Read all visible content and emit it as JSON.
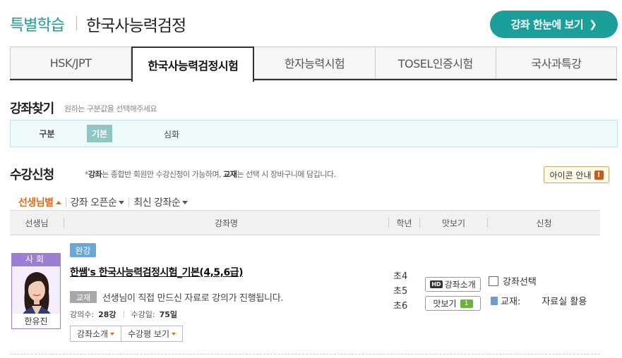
{
  "header": {
    "brand": "특별학습",
    "title": "한국사능력검정",
    "overview_button": "강좌 한눈에 보기",
    "overview_chevron": "❯"
  },
  "tabs": [
    {
      "label": "HSK/JPT",
      "active": false
    },
    {
      "label": "한국사능력검정시험",
      "active": true
    },
    {
      "label": "한자능력시험",
      "active": false
    },
    {
      "label": "TOSEL인증시험",
      "active": false
    },
    {
      "label": "국사과특강",
      "active": false
    }
  ],
  "search": {
    "title": "강좌찾기",
    "subtitle": "원하는 구분값을 선택해주세요",
    "filter_label": "구분",
    "options": [
      "기본",
      "심화"
    ]
  },
  "register": {
    "title": "수강신청",
    "notice_prefix": "*",
    "notice_bold1": "강좌",
    "notice_mid": "는 종합반 회원만 수강신청이 가능하며, ",
    "notice_bold2": "교재",
    "notice_end": "는 선택 시 장바구니에 담깁니다.",
    "icon_guide": "아이콘 안내",
    "icon_guide_mark": "!"
  },
  "sorts": [
    {
      "label": "선생님별",
      "active": true
    },
    {
      "label": "강좌 오픈순",
      "active": false
    },
    {
      "label": "최신 강좌순",
      "active": false
    }
  ],
  "table": {
    "headers": [
      "선생님",
      "강좌명",
      "학년",
      "맛보기",
      "신청"
    ]
  },
  "course": {
    "subject": "사회",
    "teacher": "한유진",
    "status": "완강",
    "title": "한쌤's 한국사능력검정시험_기본(4,5,6급)",
    "book_tag": "교재",
    "description": "선생님이 직접 만드신 자료로 강의가 진행됩니다.",
    "lectures_label": "강의수:",
    "lectures_value": "28강",
    "days_label": "수강일:",
    "days_value": "75일",
    "intro_button": "강좌소개",
    "review_button": "수강평 보기",
    "grades": [
      "초4",
      "초5",
      "초6"
    ],
    "hd_label": "HD",
    "hd_button": "강좌소개",
    "preview_button": "맛보기",
    "preview_count": "1",
    "select_label": "강좌선택",
    "book_label": "교재:",
    "book_link": "자료실 활용"
  },
  "colors": {
    "accent": "#1c9e9b",
    "sort_active": "#e06a1a",
    "subject_purple": "#9a7fd4",
    "status_blue": "#6aa6d6"
  }
}
